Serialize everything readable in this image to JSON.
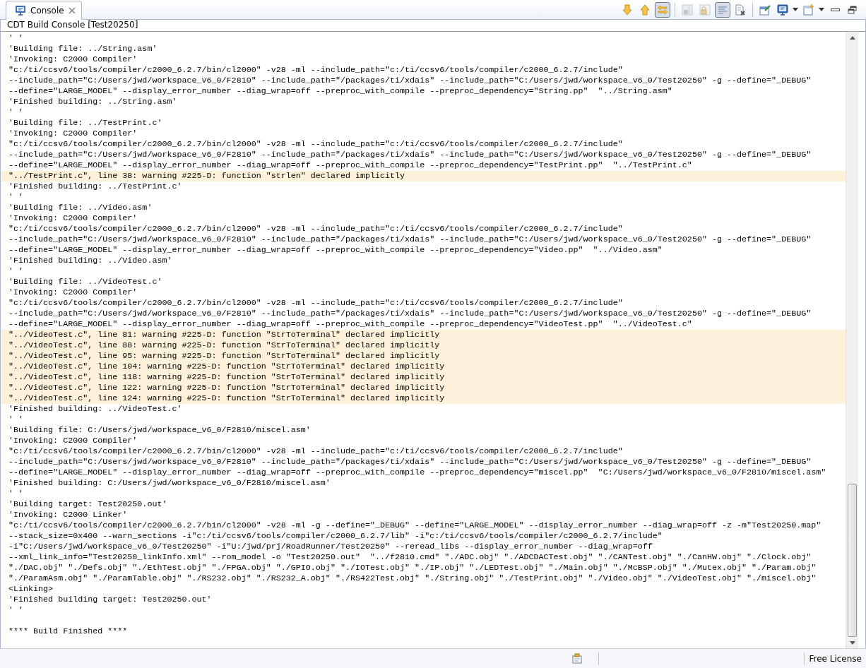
{
  "tab": {
    "label": "Console",
    "selected": true
  },
  "toolbar": [
    {
      "kind": "arrow-down",
      "pressed": false,
      "disabled": false
    },
    {
      "kind": "arrow-up",
      "pressed": false,
      "disabled": false
    },
    {
      "kind": "link",
      "pressed": true,
      "disabled": false
    },
    {
      "kind": "sep"
    },
    {
      "kind": "save-panel",
      "pressed": false,
      "disabled": true
    },
    {
      "kind": "lock-panel",
      "pressed": false,
      "disabled": true
    },
    {
      "kind": "lines",
      "pressed": true,
      "disabled": false
    },
    {
      "kind": "clear",
      "pressed": false,
      "disabled": false
    },
    {
      "kind": "sep"
    },
    {
      "kind": "pin",
      "pressed": false,
      "disabled": false
    },
    {
      "kind": "monitor",
      "pressed": false,
      "disabled": false
    },
    {
      "kind": "dropdown"
    },
    {
      "kind": "new-console",
      "pressed": false,
      "disabled": false
    },
    {
      "kind": "dropdown"
    },
    {
      "kind": "minimize",
      "pressed": false,
      "disabled": false
    },
    {
      "kind": "restore",
      "pressed": false,
      "disabled": false
    }
  ],
  "console_title": "CDT Build Console [Test20250]",
  "lines": [
    {
      "kind": "normal",
      "text": "' '"
    },
    {
      "kind": "normal",
      "text": "'Building file: ../String.asm'"
    },
    {
      "kind": "normal",
      "text": "'Invoking: C2000 Compiler'"
    },
    {
      "kind": "normal",
      "text": "\"c:/ti/ccsv6/tools/compiler/c2000_6.2.7/bin/cl2000\" -v28 -ml --include_path=\"c:/ti/ccsv6/tools/compiler/c2000_6.2.7/include\""
    },
    {
      "kind": "normal",
      "text": "--include_path=\"C:/Users/jwd/workspace_v6_0/F2810\" --include_path=\"/packages/ti/xdais\" --include_path=\"C:/Users/jwd/workspace_v6_0/Test20250\" -g --define=\"_DEBUG\""
    },
    {
      "kind": "normal",
      "text": "--define=\"LARGE_MODEL\" --display_error_number --diag_wrap=off --preproc_with_compile --preproc_dependency=\"String.pp\"  \"../String.asm\""
    },
    {
      "kind": "normal",
      "text": "'Finished building: ../String.asm'"
    },
    {
      "kind": "normal",
      "text": "' '"
    },
    {
      "kind": "normal",
      "text": "'Building file: ../TestPrint.c'"
    },
    {
      "kind": "normal",
      "text": "'Invoking: C2000 Compiler'"
    },
    {
      "kind": "normal",
      "text": "\"c:/ti/ccsv6/tools/compiler/c2000_6.2.7/bin/cl2000\" -v28 -ml --include_path=\"c:/ti/ccsv6/tools/compiler/c2000_6.2.7/include\""
    },
    {
      "kind": "normal",
      "text": "--include_path=\"C:/Users/jwd/workspace_v6_0/F2810\" --include_path=\"/packages/ti/xdais\" --include_path=\"C:/Users/jwd/workspace_v6_0/Test20250\" -g --define=\"_DEBUG\""
    },
    {
      "kind": "normal",
      "text": "--define=\"LARGE_MODEL\" --display_error_number --diag_wrap=off --preproc_with_compile --preproc_dependency=\"TestPrint.pp\"  \"../TestPrint.c\""
    },
    {
      "kind": "warning",
      "text": "\"../TestPrint.c\", line 38: warning #225-D: function \"strlen\" declared implicitly"
    },
    {
      "kind": "normal",
      "text": "'Finished building: ../TestPrint.c'"
    },
    {
      "kind": "normal",
      "text": "' '"
    },
    {
      "kind": "normal",
      "text": "'Building file: ../Video.asm'"
    },
    {
      "kind": "normal",
      "text": "'Invoking: C2000 Compiler'"
    },
    {
      "kind": "normal",
      "text": "\"c:/ti/ccsv6/tools/compiler/c2000_6.2.7/bin/cl2000\" -v28 -ml --include_path=\"c:/ti/ccsv6/tools/compiler/c2000_6.2.7/include\""
    },
    {
      "kind": "normal",
      "text": "--include_path=\"C:/Users/jwd/workspace_v6_0/F2810\" --include_path=\"/packages/ti/xdais\" --include_path=\"C:/Users/jwd/workspace_v6_0/Test20250\" -g --define=\"_DEBUG\""
    },
    {
      "kind": "normal",
      "text": "--define=\"LARGE_MODEL\" --display_error_number --diag_wrap=off --preproc_with_compile --preproc_dependency=\"Video.pp\"  \"../Video.asm\""
    },
    {
      "kind": "normal",
      "text": "'Finished building: ../Video.asm'"
    },
    {
      "kind": "normal",
      "text": "' '"
    },
    {
      "kind": "normal",
      "text": "'Building file: ../VideoTest.c'"
    },
    {
      "kind": "normal",
      "text": "'Invoking: C2000 Compiler'"
    },
    {
      "kind": "normal",
      "text": "\"c:/ti/ccsv6/tools/compiler/c2000_6.2.7/bin/cl2000\" -v28 -ml --include_path=\"c:/ti/ccsv6/tools/compiler/c2000_6.2.7/include\""
    },
    {
      "kind": "normal",
      "text": "--include_path=\"C:/Users/jwd/workspace_v6_0/F2810\" --include_path=\"/packages/ti/xdais\" --include_path=\"C:/Users/jwd/workspace_v6_0/Test20250\" -g --define=\"_DEBUG\""
    },
    {
      "kind": "normal",
      "text": "--define=\"LARGE_MODEL\" --display_error_number --diag_wrap=off --preproc_with_compile --preproc_dependency=\"VideoTest.pp\"  \"../VideoTest.c\""
    },
    {
      "kind": "warning",
      "text": "\"../VideoTest.c\", line 81: warning #225-D: function \"StrToTerminal\" declared implicitly"
    },
    {
      "kind": "warning",
      "text": "\"../VideoTest.c\", line 88: warning #225-D: function \"StrToTerminal\" declared implicitly"
    },
    {
      "kind": "warning",
      "text": "\"../VideoTest.c\", line 95: warning #225-D: function \"StrToTerminal\" declared implicitly"
    },
    {
      "kind": "warning",
      "text": "\"../VideoTest.c\", line 104: warning #225-D: function \"StrToTerminal\" declared implicitly"
    },
    {
      "kind": "warning",
      "text": "\"../VideoTest.c\", line 118: warning #225-D: function \"StrToTerminal\" declared implicitly"
    },
    {
      "kind": "warning",
      "text": "\"../VideoTest.c\", line 122: warning #225-D: function \"StrToTerminal\" declared implicitly"
    },
    {
      "kind": "warning",
      "text": "\"../VideoTest.c\", line 124: warning #225-D: function \"StrToTerminal\" declared implicitly"
    },
    {
      "kind": "normal",
      "text": "'Finished building: ../VideoTest.c'"
    },
    {
      "kind": "normal",
      "text": "' '"
    },
    {
      "kind": "normal",
      "text": "'Building file: C:/Users/jwd/workspace_v6_0/F2810/miscel.asm'"
    },
    {
      "kind": "normal",
      "text": "'Invoking: C2000 Compiler'"
    },
    {
      "kind": "normal",
      "text": "\"c:/ti/ccsv6/tools/compiler/c2000_6.2.7/bin/cl2000\" -v28 -ml --include_path=\"c:/ti/ccsv6/tools/compiler/c2000_6.2.7/include\""
    },
    {
      "kind": "normal",
      "text": "--include_path=\"C:/Users/jwd/workspace_v6_0/F2810\" --include_path=\"/packages/ti/xdais\" --include_path=\"C:/Users/jwd/workspace_v6_0/Test20250\" -g --define=\"_DEBUG\""
    },
    {
      "kind": "normal",
      "text": "--define=\"LARGE_MODEL\" --display_error_number --diag_wrap=off --preproc_with_compile --preproc_dependency=\"miscel.pp\"  \"C:/Users/jwd/workspace_v6_0/F2810/miscel.asm\""
    },
    {
      "kind": "normal",
      "text": "'Finished building: C:/Users/jwd/workspace_v6_0/F2810/miscel.asm'"
    },
    {
      "kind": "normal",
      "text": "' '"
    },
    {
      "kind": "normal",
      "text": "'Building target: Test20250.out'"
    },
    {
      "kind": "normal",
      "text": "'Invoking: C2000 Linker'"
    },
    {
      "kind": "normal",
      "text": "\"c:/ti/ccsv6/tools/compiler/c2000_6.2.7/bin/cl2000\" -v28 -ml -g --define=\"_DEBUG\" --define=\"LARGE_MODEL\" --display_error_number --diag_wrap=off -z -m\"Test20250.map\""
    },
    {
      "kind": "normal",
      "text": "--stack_size=0x400 --warn_sections -i\"c:/ti/ccsv6/tools/compiler/c2000_6.2.7/lib\" -i\"c:/ti/ccsv6/tools/compiler/c2000_6.2.7/include\""
    },
    {
      "kind": "normal",
      "text": "-i\"C:/Users/jwd/workspace_v6_0/Test20250\" -i\"U:/jwd/prj/RoadRunner/Test20250\" --reread_libs --display_error_number --diag_wrap=off"
    },
    {
      "kind": "normal",
      "text": "--xml_link_info=\"Test20250_linkInfo.xml\" --rom_model -o \"Test20250.out\"  \"../f2810.cmd\" \"./ADC.obj\" \"./ADCDACTest.obj\" \"./CANTest.obj\" \"./CanHW.obj\" \"./Clock.obj\""
    },
    {
      "kind": "normal",
      "text": "\"./DAC.obj\" \"./Defs.obj\" \"./EthTest.obj\" \"./FPGA.obj\" \"./GPIO.obj\" \"./IOTest.obj\" \"./IP.obj\" \"./LEDTest.obj\" \"./Main.obj\" \"./McBSP.obj\" \"./Mutex.obj\" \"./Param.obj\""
    },
    {
      "kind": "normal",
      "text": "\"./ParamAsm.obj\" \"./ParamTable.obj\" \"./RS232.obj\" \"./RS232_A.obj\" \"./RS422Test.obj\" \"./String.obj\" \"./TestPrint.obj\" \"./Video.obj\" \"./VideoTest.obj\" \"./miscel.obj\""
    },
    {
      "kind": "normal",
      "text": "<Linking>"
    },
    {
      "kind": "normal",
      "text": "'Finished building target: Test20250.out'"
    },
    {
      "kind": "normal",
      "text": "' '"
    },
    {
      "kind": "blank"
    },
    {
      "kind": "normal",
      "text": "**** Build Finished ****"
    }
  ],
  "status_bar": {
    "license": "Free License"
  }
}
